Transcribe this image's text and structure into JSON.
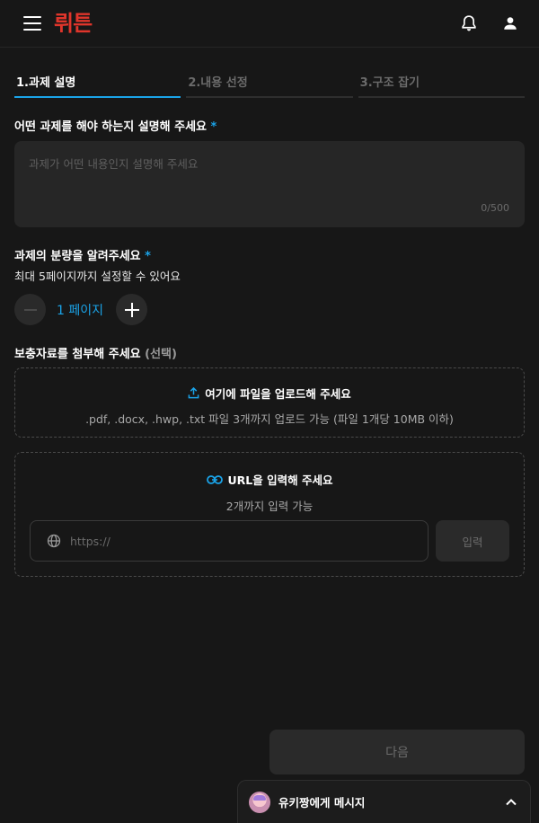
{
  "header": {
    "logo": "뤼튼",
    "icons": [
      "menu-icon",
      "bell-icon",
      "user-icon"
    ]
  },
  "tabs": [
    {
      "label": "1.과제 설명",
      "active": true
    },
    {
      "label": "2.내용 선정",
      "active": false
    },
    {
      "label": "3.구조 잡기",
      "active": false
    }
  ],
  "description": {
    "title": "어떤 과제를 해야 하는지 설명해 주세요",
    "required_mark": "*",
    "placeholder": "과제가 어떤 내용인지 설명해 주세요",
    "char_count": "0/500"
  },
  "amount": {
    "title": "과제의 분량을 알려주세요",
    "required_mark": "*",
    "subtitle": "최대 5페이지까지 설정할 수 있어요",
    "value": "1 페이지"
  },
  "attachments": {
    "title": "보충자료를 첨부해 주세요",
    "optional_label": "(선택)",
    "upload_title": "여기에 파일을 업로드해 주세요",
    "upload_desc": ".pdf, .docx, .hwp, .txt 파일 3개까지 업로드 가능 (파일 1개당 10MB 이하)",
    "url_title": "URL을 입력해 주세요",
    "url_desc": "2개까지 입력 가능",
    "url_placeholder": "https://",
    "url_submit": "입력"
  },
  "footer": {
    "next_label": "다음",
    "message_label": "유키짱에게 메시지"
  },
  "colors": {
    "accent": "#1aa3e8",
    "logo": "#e0352b",
    "background": "#171717",
    "surface": "#262626"
  }
}
